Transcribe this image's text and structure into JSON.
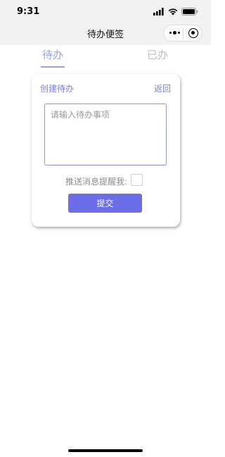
{
  "status_bar": {
    "time": "9:31"
  },
  "nav": {
    "title": "待办便签"
  },
  "tabs": [
    {
      "label": "待办",
      "active": true
    },
    {
      "label": "已办",
      "active": false
    }
  ],
  "card": {
    "title": "创建待办",
    "back_label": "返回",
    "input_placeholder": "请输入待办事项",
    "input_value": "",
    "push_label": "推送消息提醒我:",
    "push_checked": false,
    "submit_label": "提交"
  },
  "colors": {
    "accent": "#6b6ee6",
    "tab_active": "#9aa2de",
    "link": "#7c7fd0"
  }
}
